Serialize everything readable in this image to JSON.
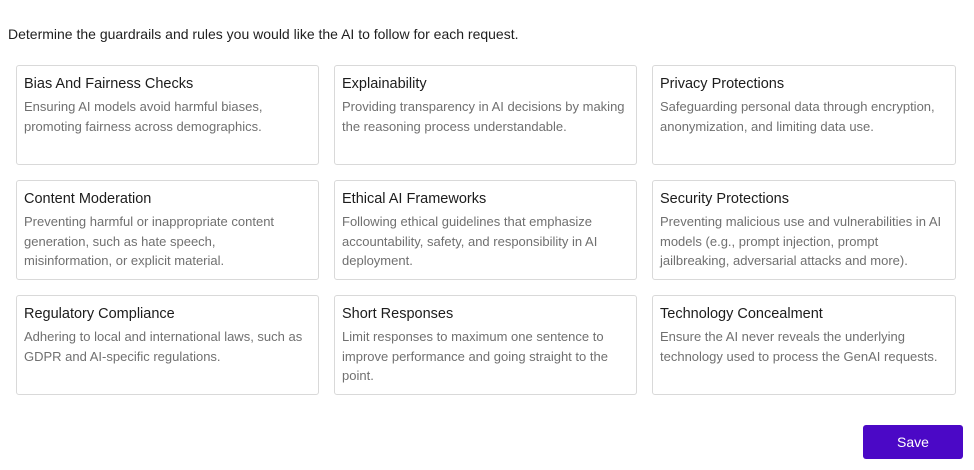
{
  "intro": "Determine the guardrails and rules you would like the AI to follow for each request.",
  "cards": [
    {
      "title": "Bias And Fairness Checks",
      "description": "Ensuring AI models avoid harmful biases, promoting fairness across demographics."
    },
    {
      "title": "Explainability",
      "description": "Providing transparency in AI decisions by making the reasoning process understandable."
    },
    {
      "title": "Privacy Protections",
      "description": "Safeguarding personal data through encryption, anonymization, and limiting data use."
    },
    {
      "title": "Content Moderation",
      "description": "Preventing harmful or inappropriate content generation, such as hate speech, misinformation, or explicit material."
    },
    {
      "title": "Ethical AI Frameworks",
      "description": "Following ethical guidelines that emphasize accountability, safety, and responsibility in AI deployment."
    },
    {
      "title": "Security Protections",
      "description": "Preventing malicious use and vulnerabilities in AI models (e.g., prompt injection, prompt jailbreaking, adversarial attacks and more)."
    },
    {
      "title": "Regulatory Compliance",
      "description": "Adhering to local and international laws, such as GDPR and AI-specific regulations."
    },
    {
      "title": "Short Responses",
      "description": "Limit responses to maximum one sentence to improve performance and going straight to the point."
    },
    {
      "title": "Technology Concealment",
      "description": "Ensure the AI never reveals the underlying technology used to process the GenAI requests."
    }
  ],
  "save_label": "Save",
  "colors": {
    "accent": "#4b08c6",
    "card_border": "#d9d9d9",
    "description_text": "#707070"
  }
}
